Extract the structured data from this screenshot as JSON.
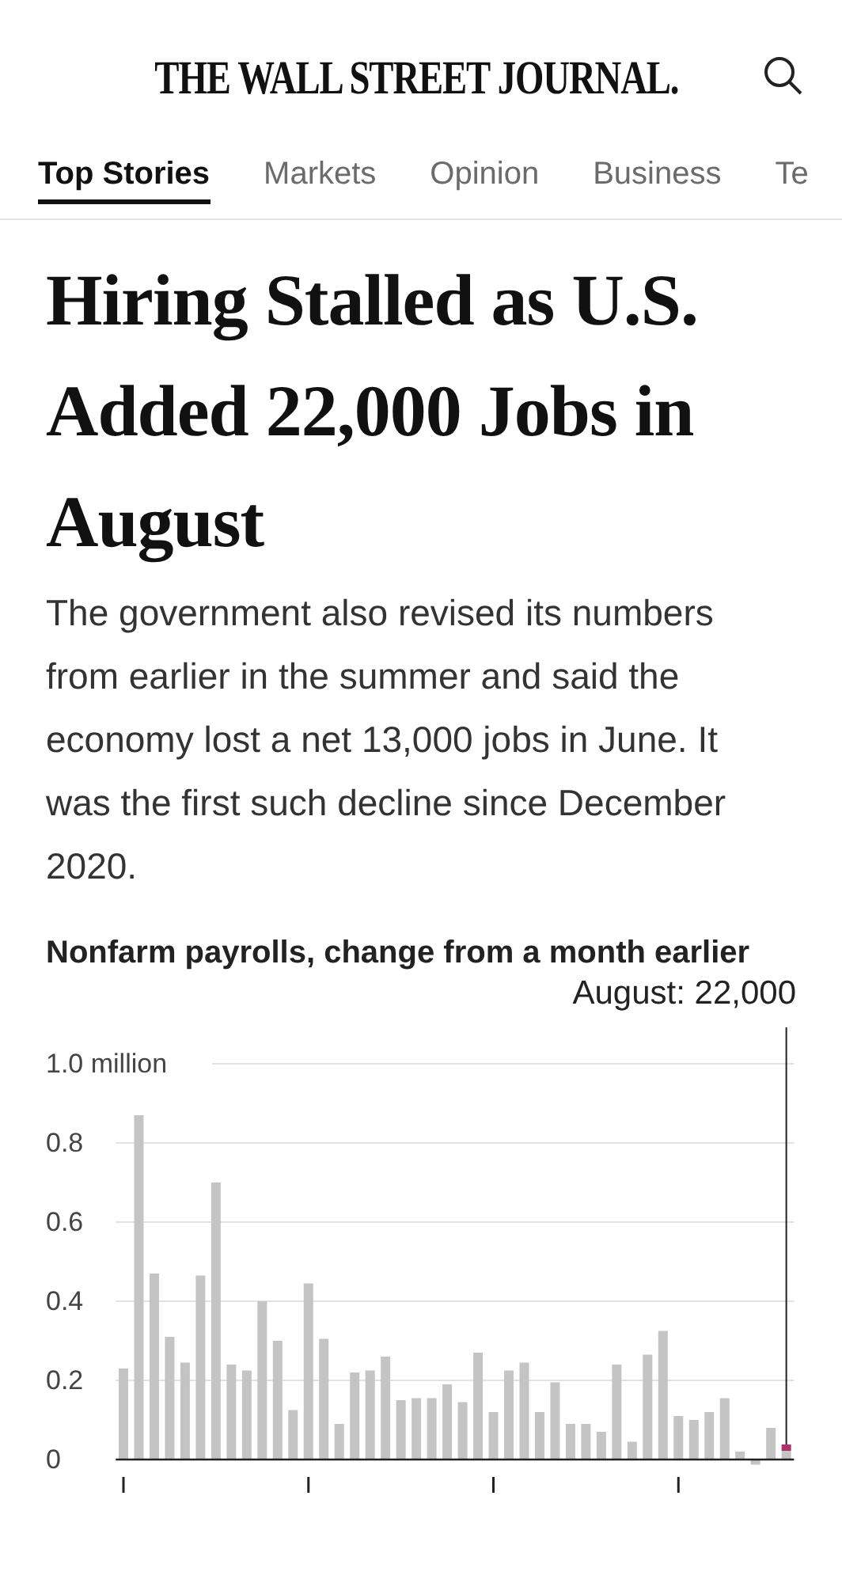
{
  "masthead": {
    "logo": "THE WALL STREET JOURNAL."
  },
  "tabs": [
    {
      "label": "Top Stories",
      "selected": true
    },
    {
      "label": "Markets",
      "selected": false
    },
    {
      "label": "Opinion",
      "selected": false
    },
    {
      "label": "Business",
      "selected": false
    },
    {
      "label": "Te",
      "selected": false
    }
  ],
  "article": {
    "headline": "Hiring Stalled as U.S. Added 22,000 Jobs in August",
    "dek": "The government also revised its numbers from earlier in the summer and said the economy lost a net 13,000 jobs in June. It was the first such decline since December 2020."
  },
  "chart": {
    "title": "Nonfarm payrolls, change from a month earlier",
    "chart_data": {
      "type": "bar",
      "grid": true,
      "ylim": [
        -0.02,
        1.0
      ],
      "yticks": [
        0,
        0.2,
        0.4,
        0.6,
        0.8,
        {
          "value": 1.0,
          "label": "1.0 million"
        }
      ],
      "color": "#c4c4c4",
      "annotations": [
        "August: 22,000"
      ],
      "categories": [
        null,
        null,
        null,
        null,
        null,
        null,
        null,
        null,
        null,
        null,
        null,
        null,
        null,
        null,
        null,
        null,
        null,
        null,
        null,
        null,
        null,
        null,
        null,
        null,
        null,
        null,
        null,
        null,
        null,
        null,
        null,
        null,
        null,
        null,
        null,
        null,
        null,
        null,
        null,
        null,
        null,
        null,
        null,
        null
      ],
      "values": [
        0.23,
        0.87,
        0.47,
        0.31,
        0.245,
        0.465,
        0.7,
        0.24,
        0.225,
        0.4,
        0.3,
        0.125,
        0.445,
        0.305,
        0.09,
        0.22,
        0.225,
        0.26,
        0.15,
        0.155,
        0.155,
        0.19,
        0.145,
        0.27,
        0.12,
        0.225,
        0.245,
        0.12,
        0.195,
        0.09,
        0.09,
        0.07,
        0.24,
        0.045,
        0.265,
        0.325,
        0.11,
        0.1,
        0.12,
        0.155,
        0.02,
        -0.013,
        0.08,
        0.022
      ]
    }
  }
}
